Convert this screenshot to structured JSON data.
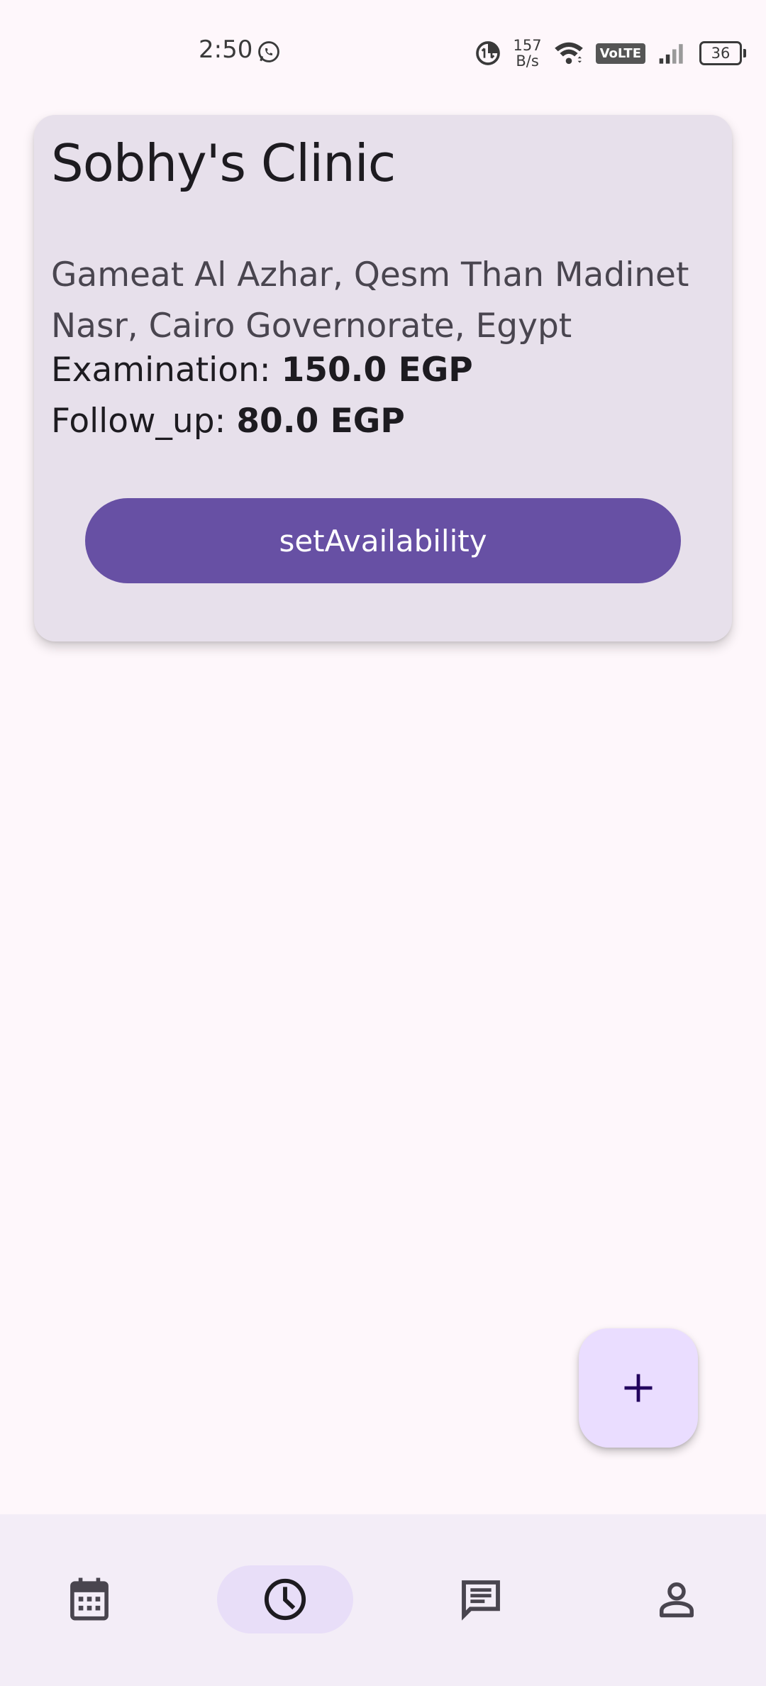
{
  "status_bar": {
    "time": "2:50",
    "net_speed_value": "157",
    "net_speed_unit": "B/s",
    "volte": "VoLTE",
    "battery": "36"
  },
  "clinic": {
    "name": "Sobhy's Clinic",
    "address": "Gameat Al Azhar, Qesm Than Madinet Nasr, Cairo Governorate, Egypt",
    "examination_label": "Examination: ",
    "examination_value": "150.0 EGP",
    "follow_up_label": "Follow_up: ",
    "follow_up_value": "80.0 EGP",
    "button_label": "setAvailability"
  },
  "fab": {
    "icon": "add-icon"
  },
  "bottom_nav": {
    "items": [
      {
        "icon": "calendar-icon",
        "active": false
      },
      {
        "icon": "clock-icon",
        "active": true
      },
      {
        "icon": "chat-icon",
        "active": false
      },
      {
        "icon": "person-icon",
        "active": false
      }
    ]
  },
  "colors": {
    "primary": "#6750a4",
    "card_background": "#e7e0eb",
    "fab_background": "#eaddff",
    "nav_active_indicator": "#e8def8",
    "nav_background": "#f3edf7"
  }
}
